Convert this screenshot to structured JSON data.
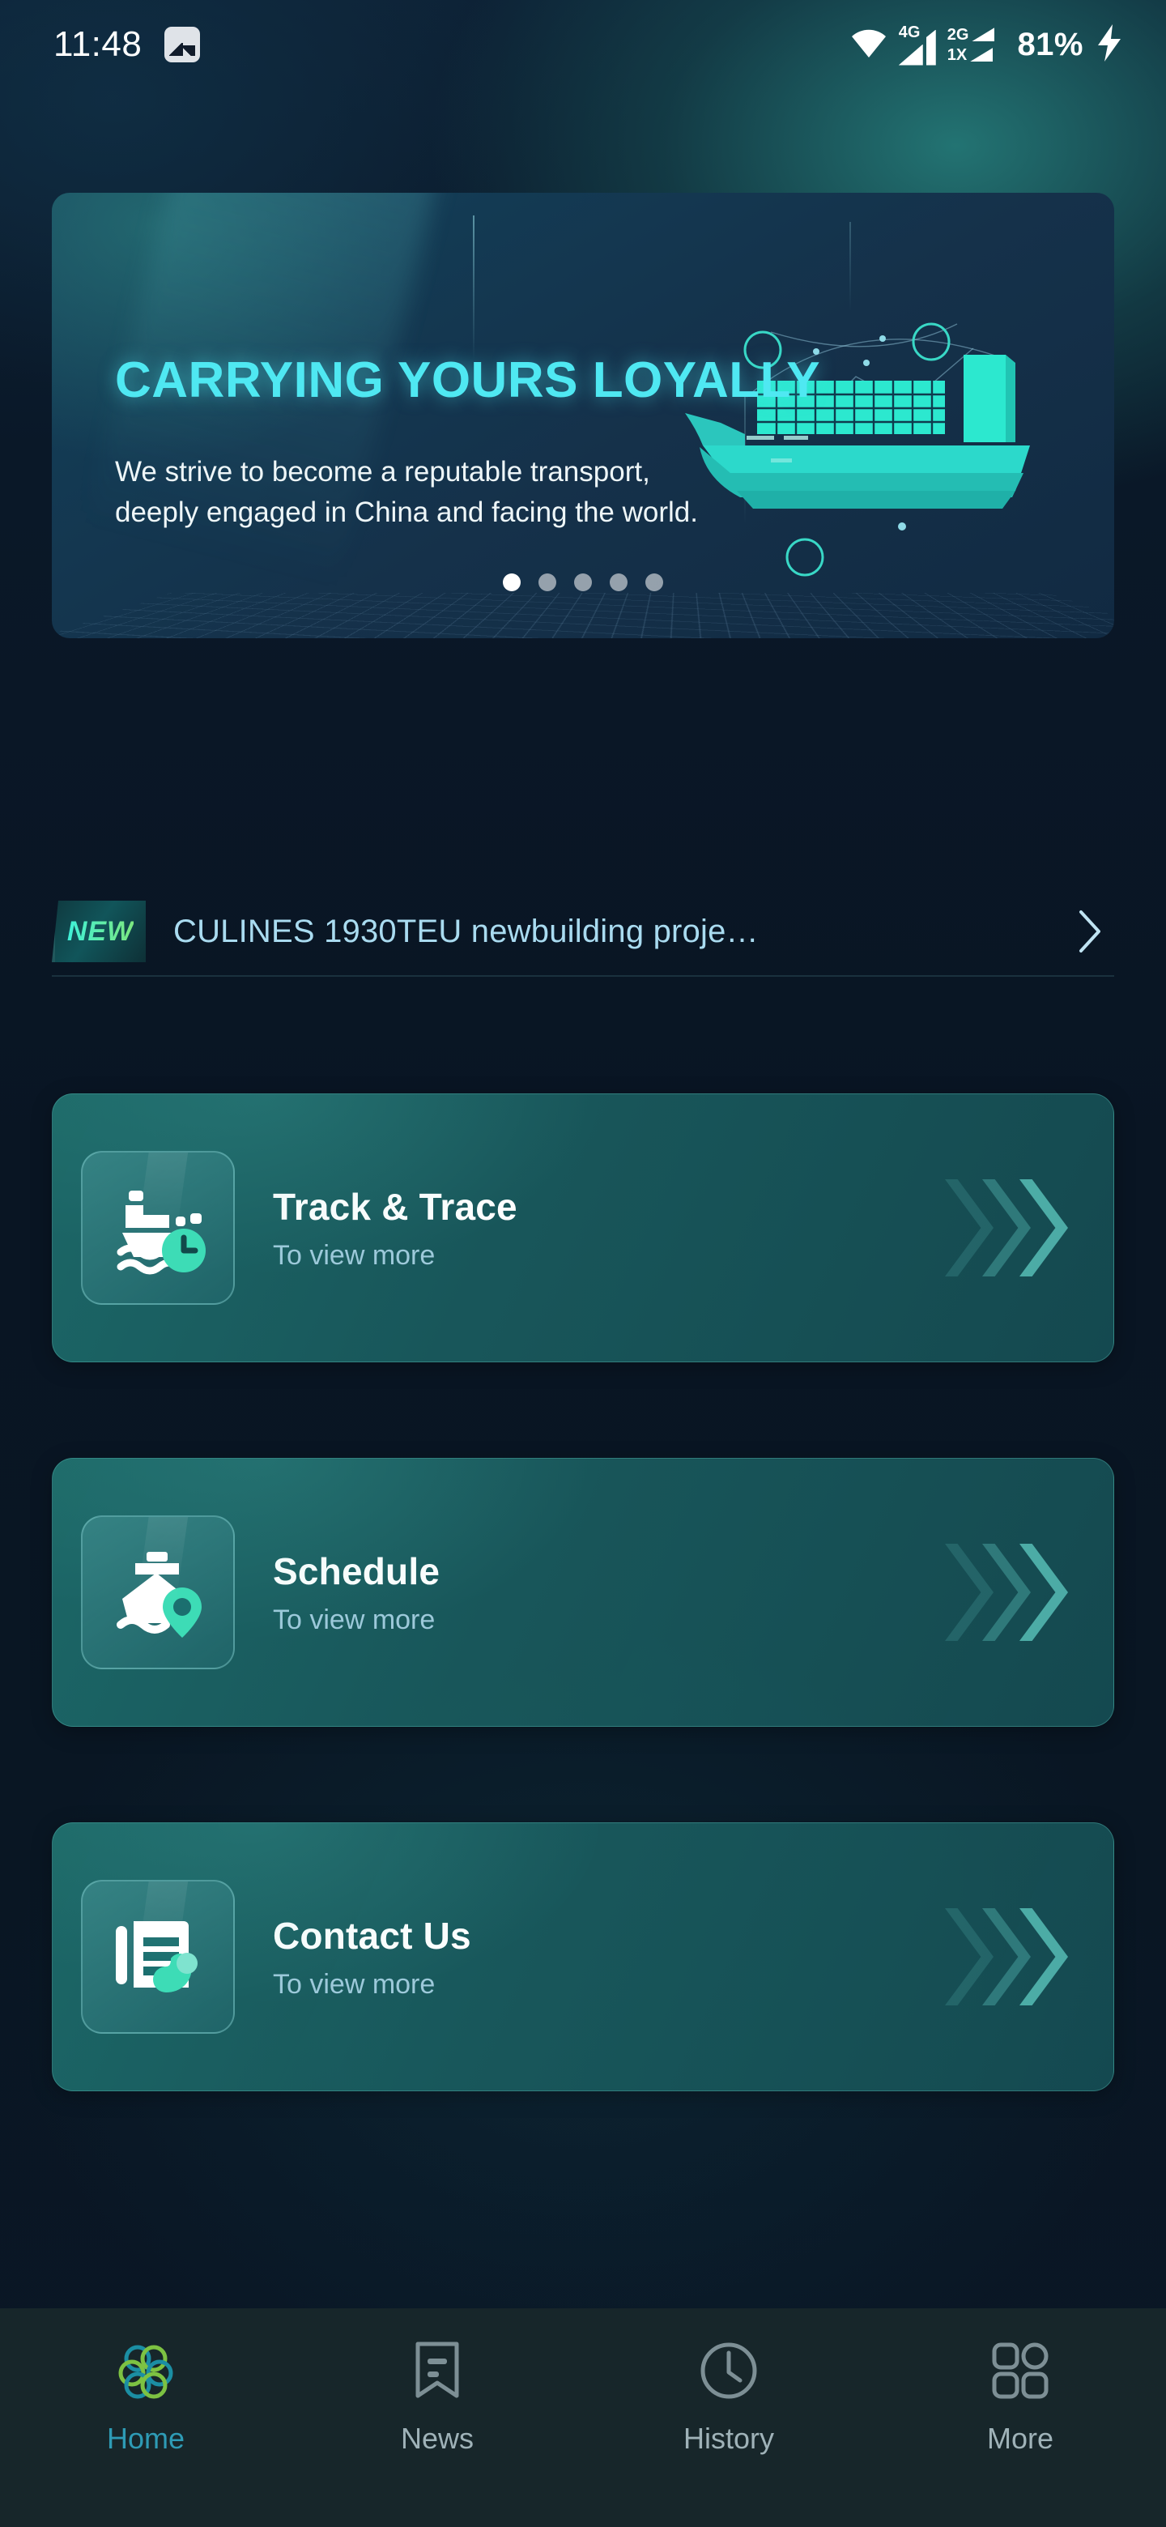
{
  "statusbar": {
    "time": "11:48",
    "gallery_icon": "image-icon",
    "wifi_icon": "wifi-icon",
    "signal1_label": "4G",
    "signal2_label": "2G",
    "signal3_label": "1X",
    "battery": "81%",
    "charging_icon": "charging-bolt-icon"
  },
  "hero": {
    "title": "CARRYING YOURS LOYALLY",
    "subtitle": "We strive to become a reputable transport, deeply engaged in China and facing the world.",
    "illustration": "container-ship-illustration",
    "dots_total": 5,
    "dots_active_index": 0,
    "accent": "#4fe8f2"
  },
  "ticker": {
    "badge": "NEW",
    "headline": "CULINES 1930TEU newbuilding proje…",
    "chevron_icon": "chevron-right-icon"
  },
  "cards": [
    {
      "id": "track",
      "title": "Track & Trace",
      "subtitle": "To view more",
      "icon": "ship-clock-icon"
    },
    {
      "id": "schedule",
      "title": "Schedule",
      "subtitle": "To view more",
      "icon": "ship-pin-icon"
    },
    {
      "id": "contact",
      "title": "Contact Us",
      "subtitle": "To view more",
      "icon": "document-phone-icon"
    }
  ],
  "bottomnav": {
    "active_index": 0,
    "active_color": "#2e9bb5",
    "items": [
      {
        "label": "Home",
        "icon": "flower-logo-icon"
      },
      {
        "label": "News",
        "icon": "bookmark-icon"
      },
      {
        "label": "History",
        "icon": "clock-icon"
      },
      {
        "label": "More",
        "icon": "grid-icon"
      }
    ]
  }
}
